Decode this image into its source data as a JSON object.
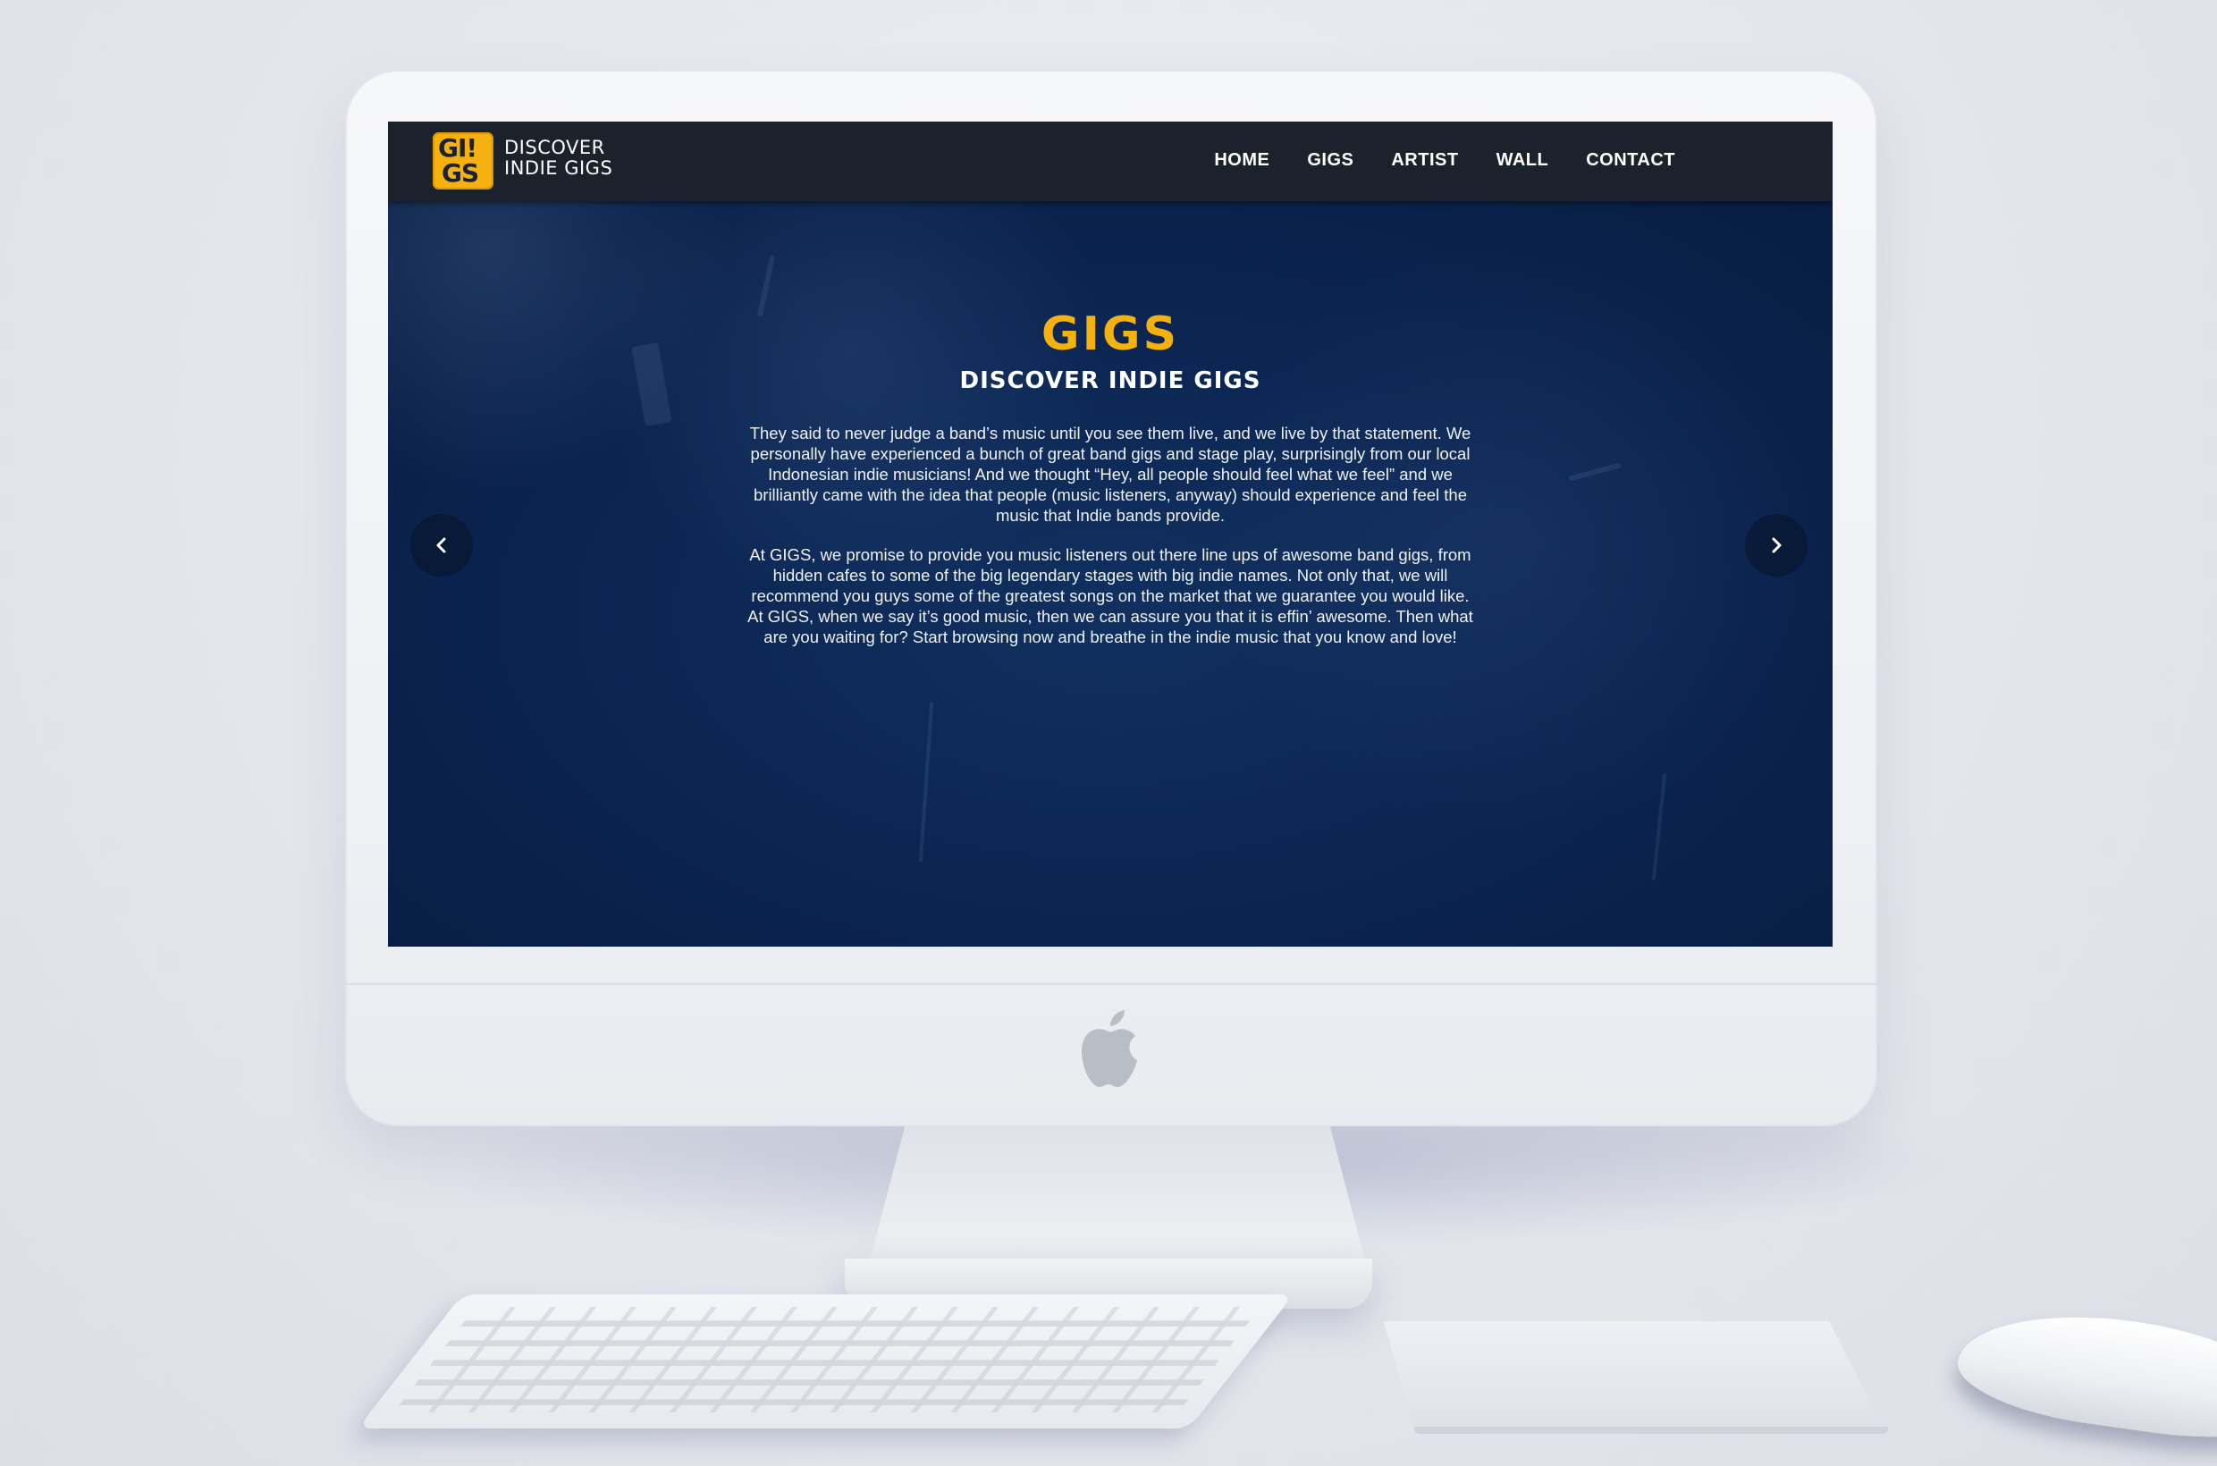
{
  "site": {
    "logo": {
      "mark_top": "GI!",
      "mark_bottom": "GS",
      "line1": "DISCOVER",
      "line2": "INDIE GIGS"
    },
    "nav": {
      "items": [
        {
          "label": "HOME"
        },
        {
          "label": "GIGS"
        },
        {
          "label": "ARTIST"
        },
        {
          "label": "WALL"
        },
        {
          "label": "CONTACT"
        }
      ]
    },
    "hero": {
      "title": "GIGS",
      "subtitle": "DISCOVER INDIE GIGS",
      "paragraph1": "They said to never judge a band’s music until you see them live, and we live by that statement. We personally have experienced a bunch of great band gigs and stage play, surprisingly from our local Indonesian indie musicians! And we thought “Hey, all people should feel what we feel” and we brilliantly came with the idea that people (music listeners, anyway) should experience and feel the music that Indie bands provide.",
      "paragraph2": "At GIGS, we promise to provide you music listeners out there line ups of awesome band gigs, from hidden cafes to some of the big legendary stages with big indie names. Not only that, we will recommend you guys some of the greatest songs on the market that we guarantee you would like. At GIGS, when we say it’s good music, then we can assure you that it is effin’ awesome. Then what are you waiting for? Start browsing now and breathe in the indie music that you know and love!"
    },
    "carousel": {
      "prev_icon": "chevron-left-icon",
      "next_icon": "chevron-right-icon"
    },
    "colors": {
      "accent": "#f4b10f",
      "navbar": "#1c222c",
      "hero_bg": "#0c2550",
      "text": "#ffffff"
    }
  },
  "device": {
    "logo_icon": "apple-logo-icon"
  }
}
